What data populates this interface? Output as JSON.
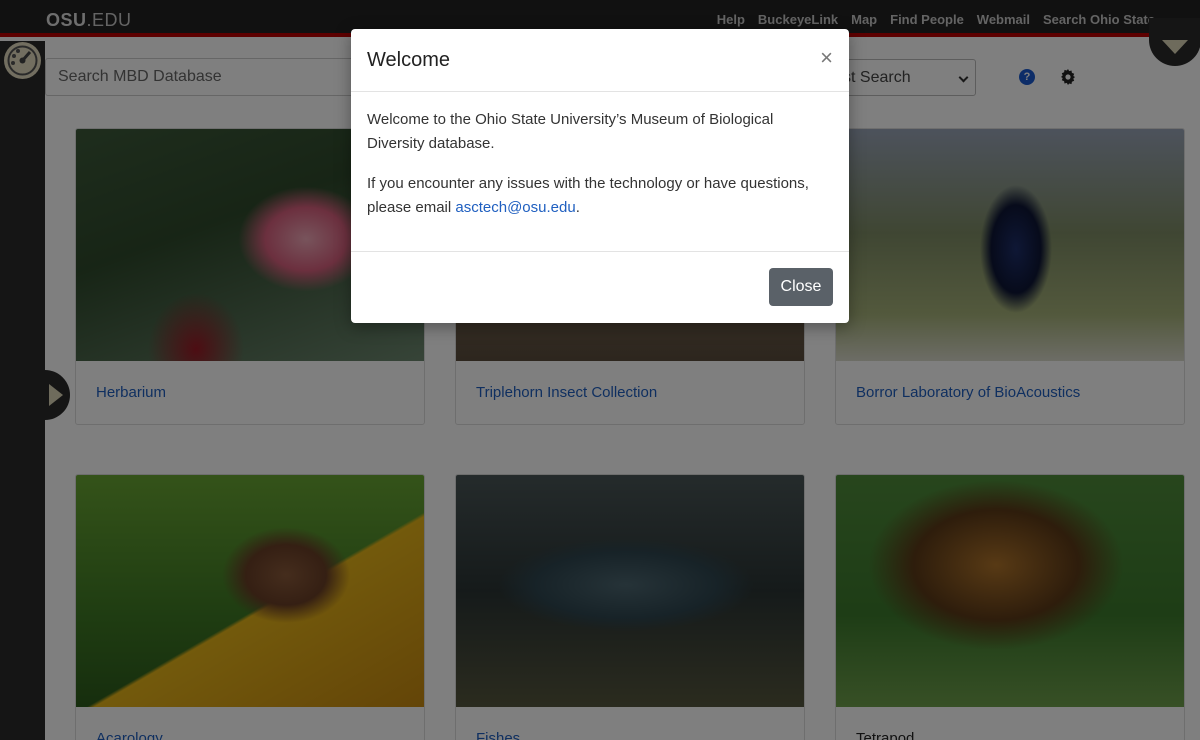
{
  "topbar": {
    "logo_bold": "OSU",
    "logo_rest": ".EDU",
    "links": [
      "Help",
      "BuckeyeLink",
      "Map",
      "Find People",
      "Webmail",
      "Search Ohio State"
    ]
  },
  "search": {
    "placeholder": "Search MBD Database",
    "select_visible_text": "st Search"
  },
  "collections": [
    {
      "label": "Herbarium",
      "link": true
    },
    {
      "label": "Triplehorn Insect Collection",
      "link": true
    },
    {
      "label": "Borror Laboratory of BioAcoustics",
      "link": true
    },
    {
      "label": "Acarology",
      "link": true
    },
    {
      "label": "Fishes",
      "link": true
    },
    {
      "label": "Tetrapod",
      "link": false
    }
  ],
  "modal": {
    "title": "Welcome",
    "close_x": "×",
    "paragraph1": "Welcome to the Ohio State University’s Museum of Biological Diversity database.",
    "paragraph2_prefix": "If you encounter any issues with the technology or have questions, please email ",
    "email": "asctech@osu.edu",
    "paragraph2_suffix": ".",
    "close_label": "Close"
  },
  "icons": {
    "help": "?",
    "colors": {
      "help": "#1a5bd0",
      "accent_red": "#bb0000",
      "link": "#1f5fc0"
    }
  }
}
